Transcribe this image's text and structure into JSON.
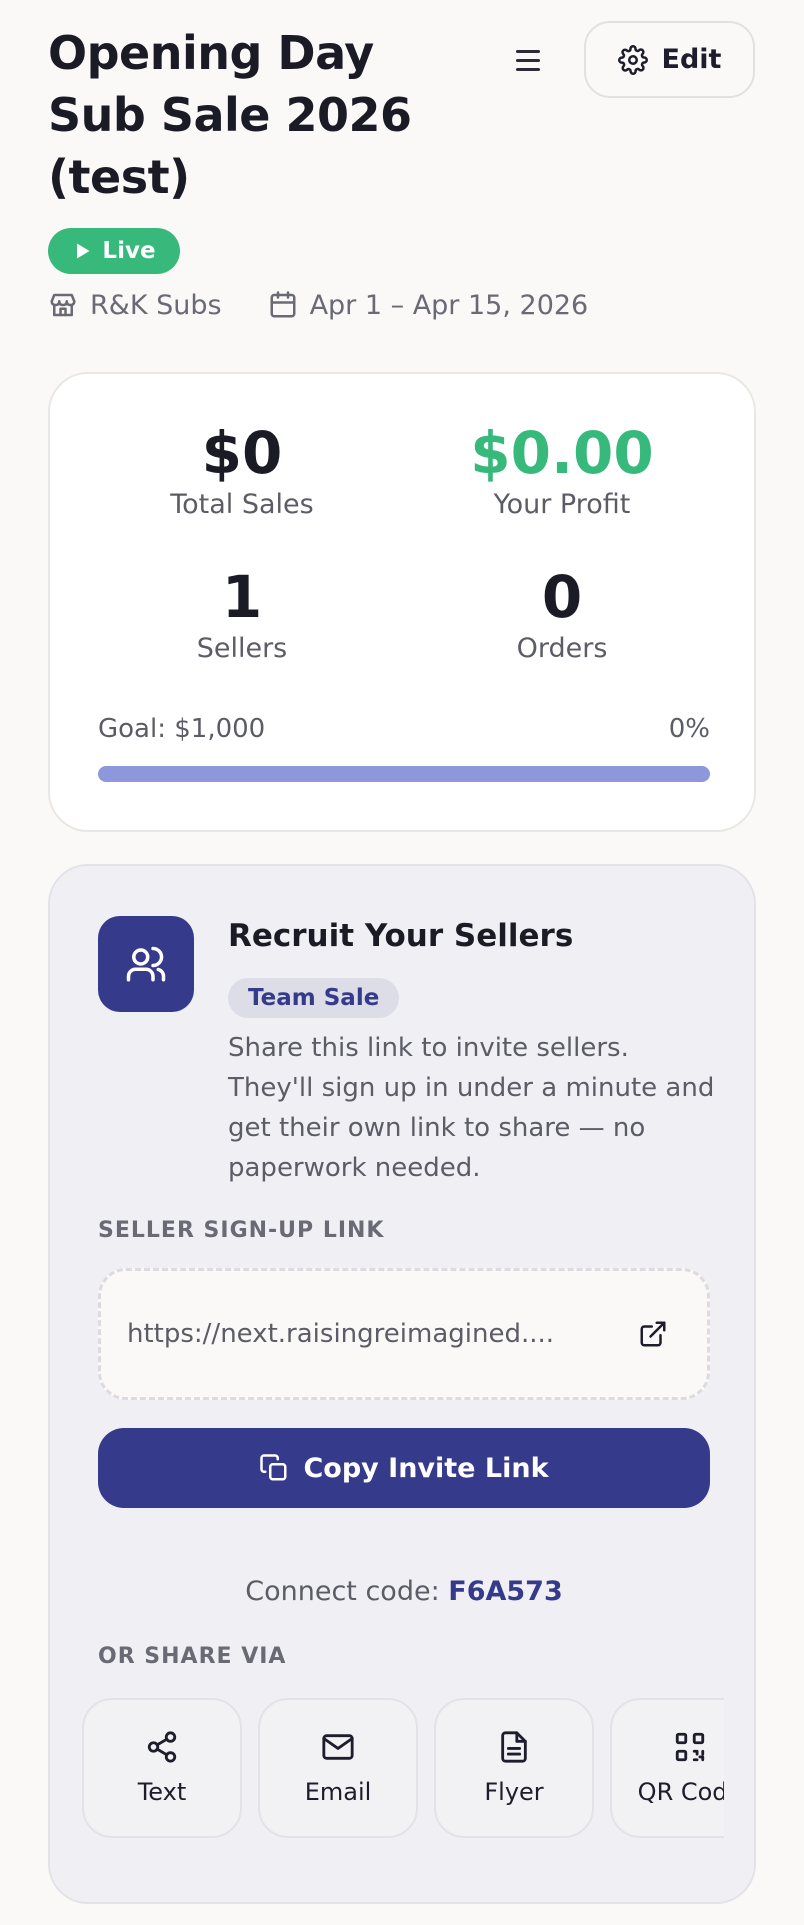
{
  "header": {
    "title": "Opening Day Sub Sale 2026 (test)",
    "edit_label": "Edit",
    "status_label": "Live",
    "business_name": "R&K Subs",
    "date_range": "Apr 1 – Apr 15, 2026"
  },
  "stats": {
    "total_sales_value": "$0",
    "total_sales_label": "Total Sales",
    "profit_value": "$0.00",
    "profit_label": "Your Profit",
    "sellers_value": "1",
    "sellers_label": "Sellers",
    "orders_value": "0",
    "orders_label": "Orders",
    "goal_label": "Goal: $1,000",
    "goal_percent_label": "0%",
    "goal_progress": 0
  },
  "recruit": {
    "title": "Recruit Your Sellers",
    "badge": "Team Sale",
    "description": "Share this link to invite sellers. They'll sign up in under a minute and get their own link to share — no paperwork needed.",
    "link_section_label": "SELLER SIGN-UP LINK",
    "link_text": "https://next.raisingreimagined....",
    "copy_button": "Copy Invite Link",
    "connect_label": "Connect code: ",
    "connect_code": "F6A573",
    "share_section_label": "OR SHARE VIA",
    "share_options": [
      {
        "label": "Text",
        "icon": "share-icon"
      },
      {
        "label": "Email",
        "icon": "mail-icon"
      },
      {
        "label": "Flyer",
        "icon": "document-icon"
      },
      {
        "label": "QR Code",
        "icon": "qr-code-icon"
      }
    ]
  },
  "colors": {
    "accent": "#363a8a",
    "live_green": "#37b97c",
    "progress_track": "#8d98dc"
  }
}
